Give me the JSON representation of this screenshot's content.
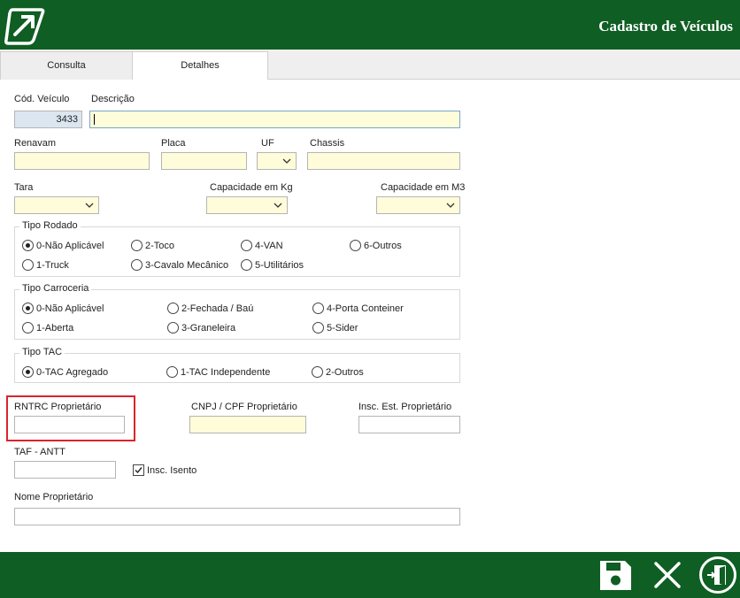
{
  "header": {
    "title": "Cadastro de Veículos",
    "logo": "arrow-logo-icon"
  },
  "tabs": [
    {
      "label": "Consulta"
    },
    {
      "label": "Detalhes",
      "active": true
    }
  ],
  "form": {
    "cod_veiculo": {
      "label": "Cód. Veículo",
      "value": "3433"
    },
    "descricao": {
      "label": "Descrição",
      "value": ""
    },
    "renavam": {
      "label": "Renavam"
    },
    "placa": {
      "label": "Placa"
    },
    "uf": {
      "label": "UF"
    },
    "chassis": {
      "label": "Chassis"
    },
    "tara": {
      "label": "Tara"
    },
    "cap_kg": {
      "label": "Capacidade em Kg"
    },
    "cap_m3": {
      "label": "Capacidade em M3"
    },
    "tipo_rodado": {
      "title": "Tipo Rodado",
      "options": [
        "0-Não Aplicável",
        "2-Toco",
        "4-VAN",
        "6-Outros",
        "1-Truck",
        "3-Cavalo Mecânico",
        "5-Utilitários"
      ],
      "selected": "0-Não Aplicável"
    },
    "tipo_carroceria": {
      "title": "Tipo Carroceria",
      "options": [
        "0-Não Aplicável",
        "2-Fechada / Baú",
        "4-Porta Conteiner",
        "1-Aberta",
        "3-Graneleira",
        "5-Sider"
      ],
      "selected": "0-Não Aplicável"
    },
    "tipo_tac": {
      "title": "Tipo TAC",
      "options": [
        "0-TAC Agregado",
        "1-TAC Independente",
        "2-Outros"
      ],
      "selected": "0-TAC Agregado"
    },
    "rntrc": {
      "label": "RNTRC Proprietário"
    },
    "cnpj": {
      "label": "CNPJ / CPF Proprietário"
    },
    "insc_est": {
      "label": "Insc. Est. Proprietário"
    },
    "taf": {
      "label": "TAF - ANTT"
    },
    "insc_isento": {
      "label": "Insc. Isento",
      "checked": true
    },
    "nome_prop": {
      "label": "Nome Proprietário"
    }
  },
  "footer": {
    "save": "save-icon",
    "cancel": "close-icon",
    "exit": "exit-door-icon"
  },
  "colors": {
    "brand_green": "#0f5e23",
    "field_yellow": "#fffcd9",
    "highlight_red": "#d9252b"
  }
}
